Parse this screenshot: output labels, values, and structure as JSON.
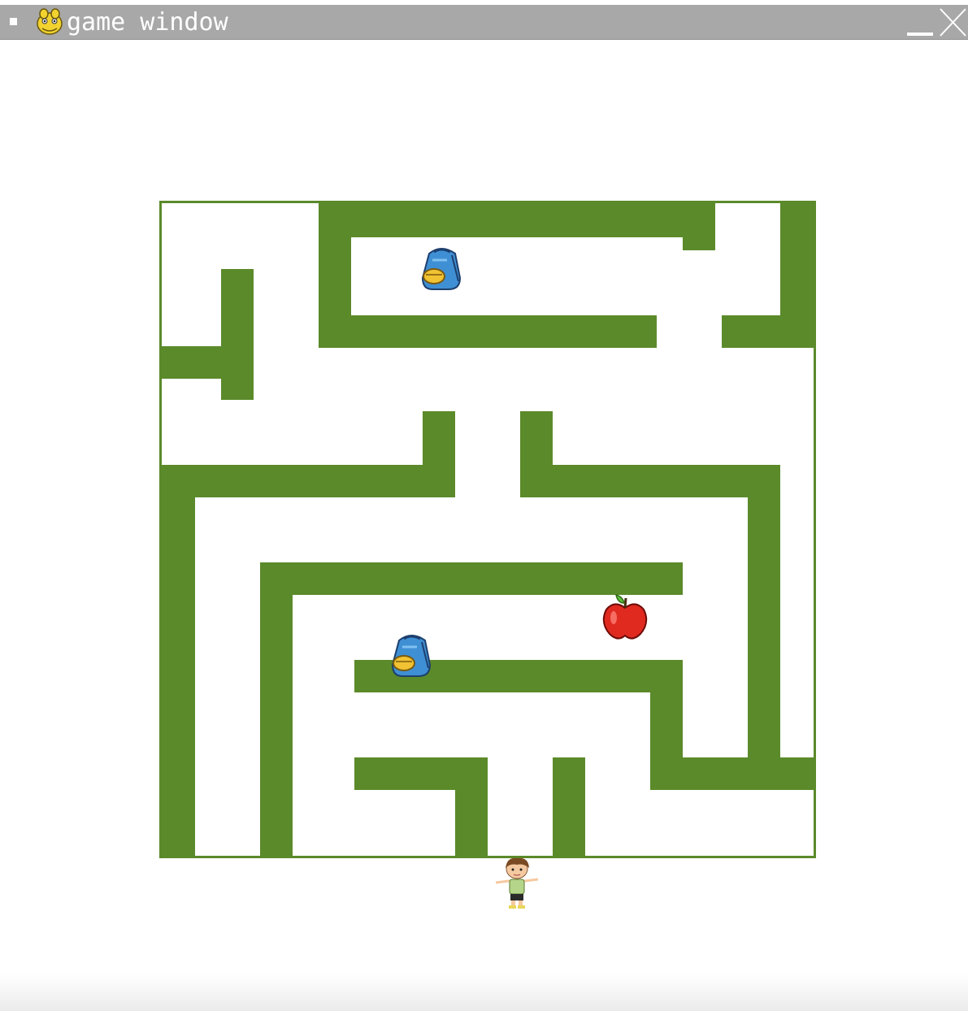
{
  "window": {
    "title": "game window",
    "titlebar_color": "#a8a8a8",
    "title_color": "#ffffff",
    "app_icon": "pygame-snake-icon",
    "controls": [
      "minimize-icon",
      "close-icon"
    ]
  },
  "game": {
    "background_color": "#ffffff",
    "wall_color": "#5b8a2a",
    "sprites": {
      "player": "boy-character",
      "backpacks": [
        "backpack-icon",
        "backpack-icon"
      ],
      "apple": "red-apple-icon"
    }
  }
}
